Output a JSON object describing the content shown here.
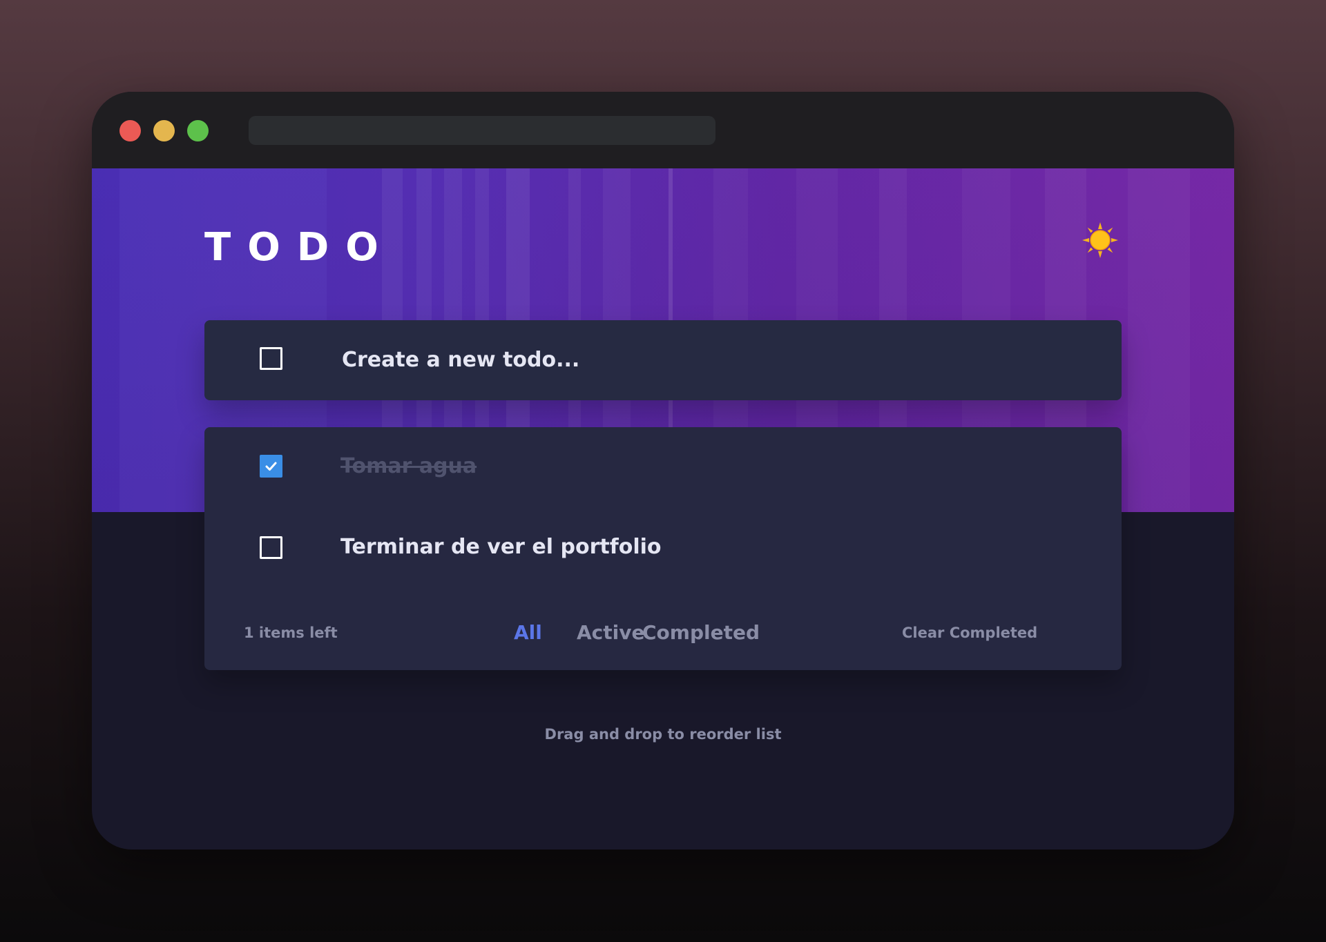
{
  "window": {
    "controls": [
      "close",
      "minimize",
      "maximize"
    ],
    "colors": {
      "close": "#ec5a55",
      "minimize": "#e4b64e",
      "maximize": "#5dc14b"
    }
  },
  "header": {
    "title": "TODO",
    "theme_icon": "sun-icon"
  },
  "new_todo": {
    "placeholder": "Create a new todo..."
  },
  "todos": [
    {
      "text": "Tomar agua",
      "completed": true
    },
    {
      "text": "Terminar de ver el portfolio",
      "completed": false
    }
  ],
  "footer": {
    "items_left": "1 items left",
    "filters": [
      "All",
      "Active",
      "Completed"
    ],
    "selected_filter": "All",
    "clear_label": "Clear Completed"
  },
  "hint": "Drag and drop to reorder list",
  "colors": {
    "accent": "#5b76e8",
    "checked": "#3a8ee6",
    "card": "#262841",
    "background": "#19182a"
  }
}
